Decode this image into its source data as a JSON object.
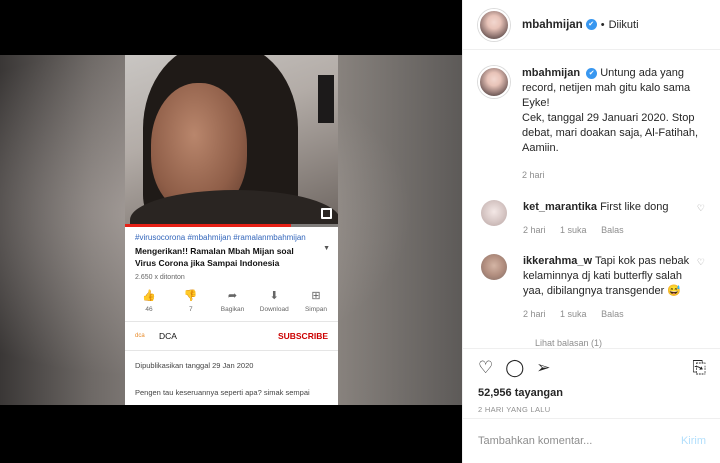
{
  "video": {
    "tags": "#virusocorona #mbahmijan #ramalanmbahmijan",
    "title": "Mengerikan!! Ramalan Mbah Mijan soal Virus Corona jika Sampai Indonesia",
    "views": "2.650 x ditonton",
    "progress": 0.78,
    "actions": [
      {
        "icon": "thumbs-up-icon",
        "label": "46"
      },
      {
        "icon": "thumbs-down-icon",
        "label": "7"
      },
      {
        "icon": "share-icon",
        "label": "Bagikan"
      },
      {
        "icon": "download-icon",
        "label": "Download"
      },
      {
        "icon": "save-icon",
        "label": "Simpan"
      }
    ],
    "channel_logo": "dca",
    "channel_name": "DCA",
    "subscribe": "SUBSCRIBE",
    "published": "Dipublikasikan tanggal 29 Jan 2020",
    "description": "Pengen tau keseruannya seperti apa? simak sempai"
  },
  "header": {
    "username": "mbahmijan",
    "follow": "Diikuti"
  },
  "caption": {
    "username": "mbahmijan",
    "text": "Untung ada yang record, netijen mah gitu kalo sama Eyke!",
    "text2": "Cek, tanggal 29 Januari 2020. Stop debat, mari doakan saja, Al-Fatihah, Aamiin.",
    "time": "2 hari"
  },
  "comments": [
    {
      "username": "ket_marantika",
      "text": "First like dong",
      "time": "2 hari",
      "likes": "1 suka",
      "reply": "Balas"
    },
    {
      "username": "ikkerahma_w",
      "text": "Tapi kok pas nebak kelaminnya dj kati butterfly salah yaa, dibilangnya transgender 😅",
      "time": "2 hari",
      "likes": "1 suka",
      "reply": "Balas"
    }
  ],
  "view_replies": "Lihat balasan (1)",
  "stats": {
    "views": "52,956 tayangan",
    "time_ago": "2 HARI YANG LALU"
  },
  "add_comment": {
    "placeholder": "Tambahkan komentar...",
    "post": "Kirim"
  },
  "colors": {
    "accent": "#3897f0",
    "subscribe": "#cc0000",
    "link": "#3366bb"
  }
}
